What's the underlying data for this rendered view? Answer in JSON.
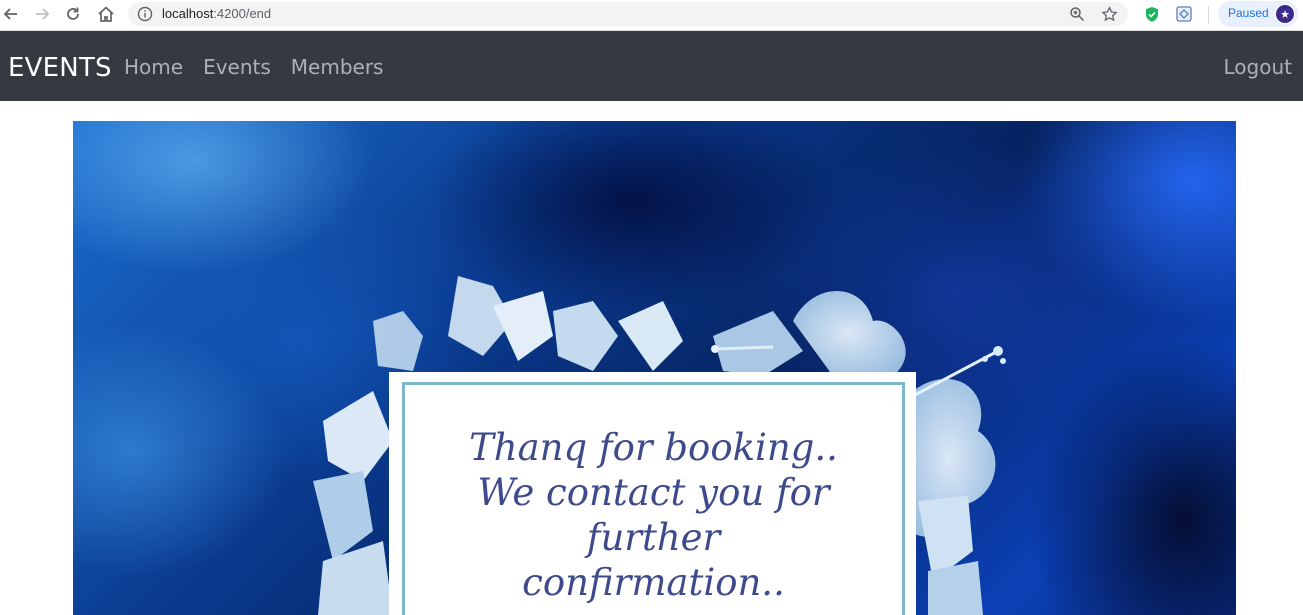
{
  "browser": {
    "url_host": "localhost",
    "url_path": ":4200/end",
    "paused_label": "Paused",
    "icons": [
      "back-icon",
      "forward-icon",
      "reload-icon",
      "home-icon",
      "site-info-icon",
      "zoom-icon",
      "bookmark-star-icon",
      "shield-extension-icon",
      "extension-icon",
      "profile-avatar-icon"
    ]
  },
  "navbar": {
    "brand": "EVENTS",
    "links": [
      "Home",
      "Events",
      "Members"
    ],
    "logout": "Logout",
    "background": "#343a40"
  },
  "hero": {
    "message_lines": [
      "Thanq for booking..",
      "We contact you for",
      "further",
      "confirmation.."
    ],
    "text_color": "#3e4a8c",
    "frame_color": "#7cb8c9"
  }
}
